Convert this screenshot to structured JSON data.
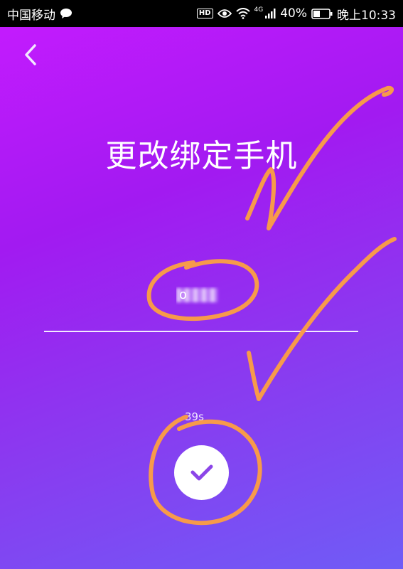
{
  "status_bar": {
    "carrier": "中国移动",
    "network_type": "4G",
    "battery": "40%",
    "time": "晚上10:33",
    "icons": [
      "message-icon",
      "hd-icon",
      "eye-icon",
      "wifi-icon",
      "signal-icon",
      "battery-icon"
    ]
  },
  "header": {
    "back_icon": "chevron-left-icon",
    "title": "更改绑定手机"
  },
  "phone": {
    "masked_value": "o"
  },
  "countdown": "39s",
  "confirm_icon": "check-icon",
  "colors": {
    "gradient_top": "#c71bff",
    "gradient_bottom": "#6f5cf6",
    "annotation": "#f79a4a",
    "check": "#8b45e8"
  }
}
